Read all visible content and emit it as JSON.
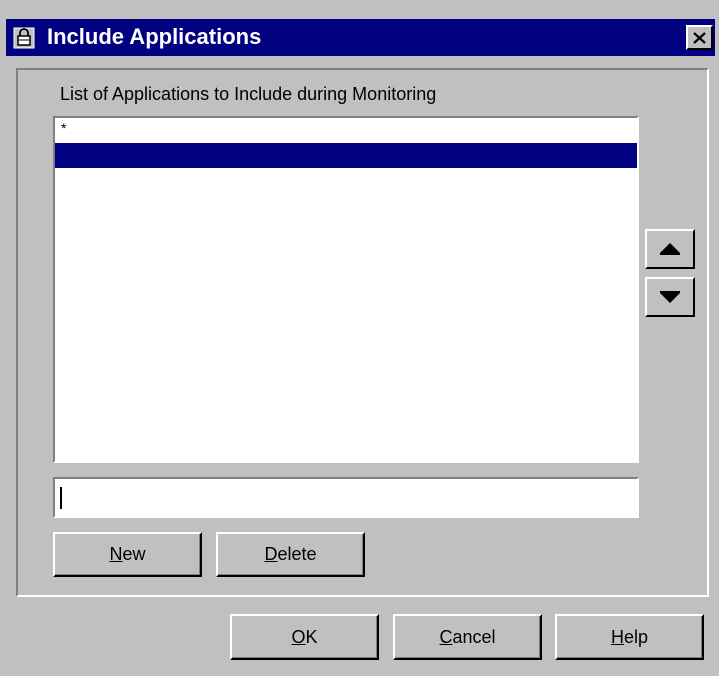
{
  "dialog": {
    "title": "Include Applications",
    "title_icon": "lock-icon",
    "close_icon": "close-icon"
  },
  "group": {
    "label": "List of Applications to Include during Monitoring"
  },
  "list": {
    "items": [
      {
        "label": "*",
        "selected": false
      },
      {
        "label": "",
        "selected": true
      }
    ]
  },
  "arrows": {
    "up_icon": "arrow-up-icon",
    "down_icon": "arrow-down-icon"
  },
  "input": {
    "value": ""
  },
  "buttons": {
    "new": {
      "mnemonic": "N",
      "rest": "ew"
    },
    "delete": {
      "mnemonic": "D",
      "rest": "elete"
    },
    "ok": {
      "mnemonic": "O",
      "rest": "K"
    },
    "cancel": {
      "mnemonic": "C",
      "rest": "ancel"
    },
    "help": {
      "mnemonic": "H",
      "rest": "elp"
    }
  },
  "colors": {
    "title_bar": "#000080",
    "selection": "#000080",
    "face": "#c0c0c0"
  }
}
